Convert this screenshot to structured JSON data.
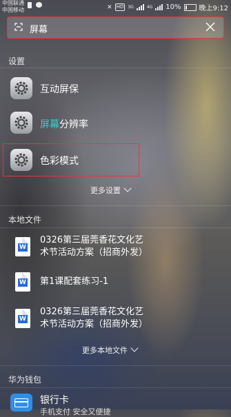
{
  "status_bar": {
    "carrier_1": "中国联通",
    "carrier_2": "中国移动",
    "hd": "HD",
    "network_1": "3G",
    "network_2": "4G",
    "battery": "10%",
    "time": "晚上9:12"
  },
  "search": {
    "value": "屏幕"
  },
  "settings_section": {
    "title": "设置",
    "items": [
      {
        "label": "互动屏保"
      },
      {
        "label_highlight": "屏幕",
        "label_rest": "分辨率"
      },
      {
        "label": "色彩模式"
      }
    ],
    "more": "更多设置"
  },
  "files_section": {
    "title": "本地文件",
    "files": [
      {
        "line1": "0326第三届莞香花文化艺",
        "line2": "术节活动方案（招商外发）"
      },
      {
        "line1": "第1课配套练习-1",
        "line2": ""
      },
      {
        "line1": "0326第三届莞香花文化艺",
        "line2": "术节活动方案（招商外发）"
      }
    ],
    "more": "更多本地文件"
  },
  "wallet_section": {
    "title": "华为钱包",
    "items": [
      {
        "label": "银行卡",
        "sublabel": "手机支付 安全又便捷"
      }
    ]
  },
  "colors": {
    "highlight": "#30d2cc",
    "annotation_red": "#e53935"
  }
}
